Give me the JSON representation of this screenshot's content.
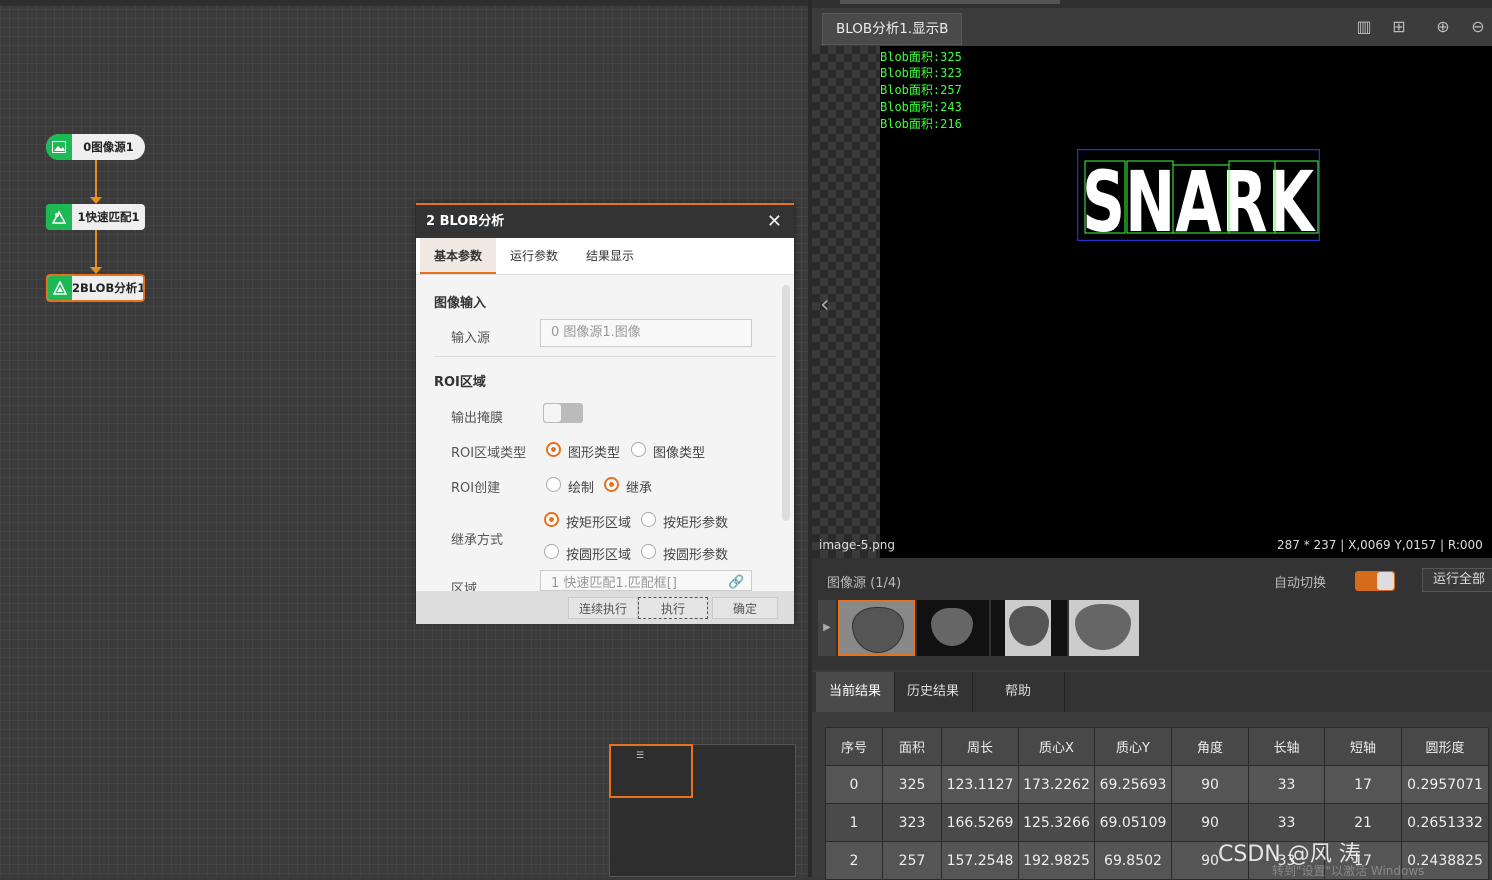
{
  "flow": {
    "nodes": [
      {
        "label": "0图像源1",
        "icon": "image-icon"
      },
      {
        "label": "1快速匹配1",
        "icon": "match-icon"
      },
      {
        "label": "2BLOB分析1",
        "icon": "blob-icon"
      }
    ]
  },
  "dialog": {
    "title": "2 BLOB分析",
    "tabs": [
      "基本参数",
      "运行参数",
      "结果显示"
    ],
    "section_image_input": "图像输入",
    "input_source_label": "输入源",
    "input_source_value": "0 图像源1.图像",
    "section_roi": "ROI区域",
    "output_mask_label": "输出掩膜",
    "roi_type_label": "ROI区域类型",
    "roi_type_options": [
      "图形类型",
      "图像类型"
    ],
    "roi_create_label": "ROI创建",
    "roi_create_options": [
      "绘制",
      "继承"
    ],
    "inherit_label": "继承方式",
    "inherit_options": [
      "按矩形区域",
      "按矩形参数",
      "按圆形区域",
      "按圆形参数"
    ],
    "region_label": "区域",
    "region_value": "1 快速匹配1.匹配框[]",
    "footer_buttons": [
      "连续执行",
      "执行",
      "确定"
    ]
  },
  "viewer": {
    "tab_title": "BLOB分析1.显示B",
    "blob_lines": [
      "Blob面积:325",
      "Blob面积:323",
      "Blob面积:257",
      "Blob面积:243",
      "Blob面积:216"
    ],
    "image_text": "SNARK",
    "filename": "image-5.png",
    "status": "287 * 237  |  X,0069  Y,0157  |  R:000"
  },
  "source_bar": {
    "title": "图像源 (1/4)",
    "auto_switch_label": "自动切换",
    "run_all_label": "运行全部"
  },
  "results": {
    "tabs": [
      "当前结果",
      "历史结果",
      "帮助"
    ],
    "columns": [
      "序号",
      "面积",
      "周长",
      "质心X",
      "质心Y",
      "角度",
      "长轴",
      "短轴",
      "圆形度"
    ],
    "rows": [
      [
        "0",
        "325",
        "123.1127",
        "173.2262",
        "69.25693",
        "90",
        "33",
        "17",
        "0.2957071"
      ],
      [
        "1",
        "323",
        "166.5269",
        "125.3266",
        "69.05109",
        "90",
        "33",
        "21",
        "0.2651332"
      ],
      [
        "2",
        "257",
        "157.2548",
        "192.9825",
        "69.8502",
        "90",
        "33",
        "17",
        "0.2438825"
      ]
    ]
  },
  "watermark": {
    "main": "CSDN @风    涛",
    "os_notice": "转到\"设置\"以激活 Windows"
  },
  "colors": {
    "accent": "#e8701e",
    "node_icon": "#1db954",
    "blob_text": "#3cff3c"
  }
}
